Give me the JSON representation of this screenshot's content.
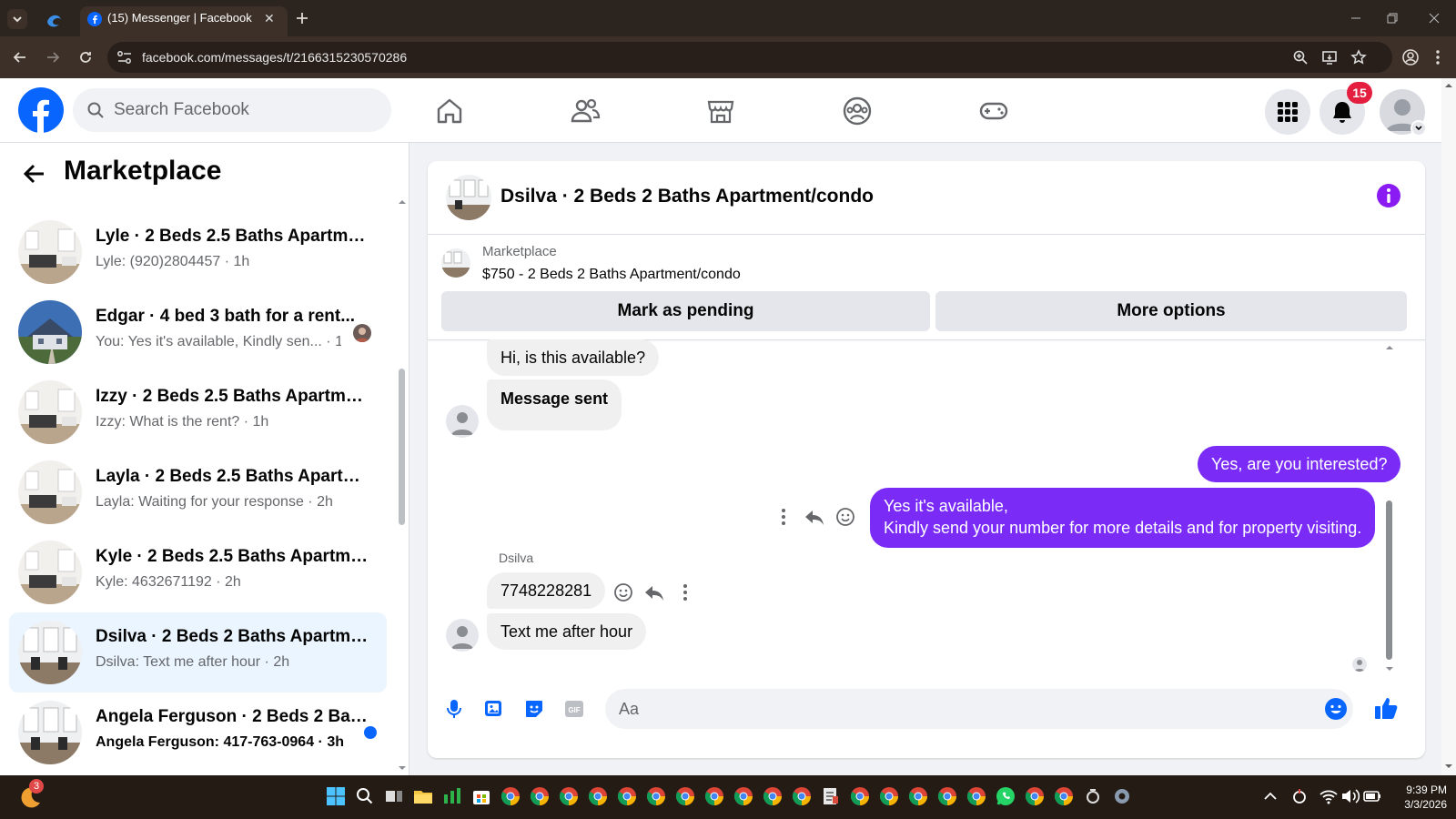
{
  "browser": {
    "tab_title": "(15) Messenger | Facebook",
    "url": "facebook.com/messages/t/2166315230570286"
  },
  "header": {
    "search_placeholder": "Search Facebook",
    "notification_count": "15"
  },
  "sidebar": {
    "title": "Marketplace",
    "conversations": [
      {
        "title": "Lyle · 2 Beds 2.5 Baths Apartmen...",
        "preview": "Lyle: (920)2804457 · 1h"
      },
      {
        "title": "Edgar · 4 bed 3 bath for a rent...",
        "preview": "You: Yes it's available, Kindly sen...  · 1h"
      },
      {
        "title": "Izzy · 2 Beds 2.5 Baths Apartmen...",
        "preview": "Izzy: What is the rent? · 1h"
      },
      {
        "title": "Layla · 2 Beds 2.5 Baths Apartme...",
        "preview": "Layla: Waiting for your response · 2h"
      },
      {
        "title": "Kyle · 2 Beds 2.5 Baths Apartmen...",
        "preview": "Kyle: 4632671192 · 2h"
      },
      {
        "title": "Dsilva · 2 Beds 2 Baths Apartmen...",
        "preview": "Dsilva: Text me after hour · 2h"
      },
      {
        "title": "Angela Ferguson · 2 Beds 2 Bat...",
        "preview": "Angela Ferguson: 417-763-0964 · 3h"
      }
    ]
  },
  "chat": {
    "title": "Dsilva · 2 Beds 2 Baths Apartment/condo",
    "listing_label": "Marketplace",
    "listing_title": "$750 - 2 Beds 2 Baths Apartment/condo",
    "mark_pending": "Mark as pending",
    "more_options": "More options",
    "messages": {
      "m1": "Hi, is this available?",
      "m2": "Message sent",
      "m3": "Yes, are you interested?",
      "m4_line1": "Yes it's available,",
      "m4_line2": "Kindly send your number for more details and for property visiting.",
      "sender": "Dsilva",
      "m5": "7748228281",
      "m6": "Text me after hour"
    },
    "composer_placeholder": "Aa"
  },
  "taskbar": {
    "weather_badge": "3",
    "time": "9:39 PM",
    "date": "3/3/2026"
  },
  "colors": {
    "brand": "#0866ff",
    "outgoing_bubble": "#7a2cf6",
    "notification": "#e41e3f",
    "selected_row": "#ebf5ff"
  }
}
